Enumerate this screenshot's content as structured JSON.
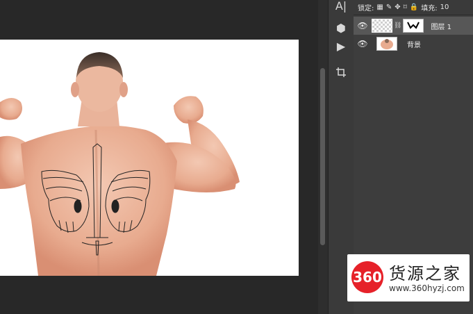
{
  "toolbar": {
    "tools": [
      {
        "icon": "character-tool-icon",
        "glyph": "A|"
      },
      {
        "icon": "3d-tool-icon",
        "glyph": "⬢"
      },
      {
        "icon": "play-icon",
        "glyph": "▶"
      },
      {
        "icon": "crop-icon",
        "glyph": "⌗"
      }
    ]
  },
  "layers_panel": {
    "lock_label": "锁定:",
    "fill_label": "填充:",
    "fill_value": "10",
    "layers": [
      {
        "name": "图层 1",
        "selected": true,
        "visible": true
      },
      {
        "name": "背景",
        "selected": false,
        "visible": true
      }
    ]
  },
  "watermark": {
    "logo_text": "360",
    "title": "货源之家",
    "url": "www.360hyzj.com"
  },
  "colors": {
    "canvas_bg": "#282828",
    "panel_bg": "#3d3d3d",
    "selected_row": "#575757",
    "logo_red": "#e62129"
  }
}
